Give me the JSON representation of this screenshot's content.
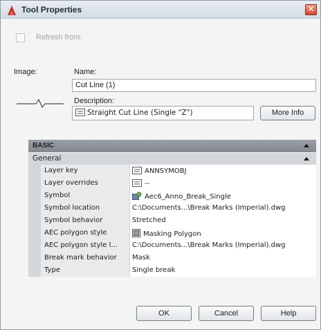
{
  "window": {
    "title": "Tool Properties",
    "close_symbol": "✕"
  },
  "refresh": {
    "label": "Refresh from:",
    "checked": false
  },
  "fields": {
    "image_label": "Image:",
    "name_label": "Name:",
    "name_value": "Cut Line (1)",
    "description_label": "Description:",
    "description_value": "Straight Cut Line (Single \"Z\")",
    "more_info_label": "More Info"
  },
  "properties": {
    "category": "BASIC",
    "group": "General",
    "rows": [
      {
        "key": "Layer key",
        "value": "ANNSYMOBJ",
        "icon": "doc-icon"
      },
      {
        "key": "Layer overrides",
        "value": "--",
        "icon": "doc-icon"
      },
      {
        "key": "Symbol",
        "value": "Aec6_Anno_Break_Single",
        "icon": "symbol-icon"
      },
      {
        "key": "Symbol location",
        "value": "C:\\Documents...\\Break Marks (Imperial).dwg",
        "icon": ""
      },
      {
        "key": "Symbol behavior",
        "value": "Stretched",
        "icon": ""
      },
      {
        "key": "AEC polygon style",
        "value": "Masking Polygon",
        "icon": "polygon-icon"
      },
      {
        "key": "AEC polygon style l...",
        "value": "C:\\Documents...\\Break Marks (Imperial).dwg",
        "icon": ""
      },
      {
        "key": "Break mark behavior",
        "value": "Mask",
        "icon": ""
      },
      {
        "key": "Type",
        "value": "Single break",
        "icon": ""
      }
    ]
  },
  "buttons": {
    "ok": "OK",
    "cancel": "Cancel",
    "help": "Help"
  },
  "colors": {
    "header_dark": "#8a8f96",
    "header_light": "#d3d6da",
    "close_red": "#d2472b",
    "app_icon_red": "#c2312a"
  }
}
